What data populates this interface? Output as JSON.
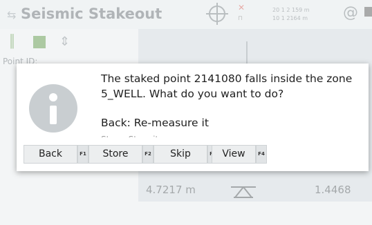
{
  "app": {
    "title": "Seismic Stakeout",
    "coord_line1": "20 1 2 159 m",
    "coord_line2": "10 1 2164 m",
    "field_label": "Point ID:",
    "value_left": "4.7217 m",
    "value_right": "1.4468",
    "icons": [
      "back-icon",
      "gps-target-icon",
      "at-icon",
      "battery-icon",
      "bars-icon",
      "grid-icon",
      "tripod-icon"
    ],
    "accent_color": "#4c8f2f"
  },
  "dialog": {
    "message": "The staked point 2141080 falls inside the zone 5_WELL. What do you want to do?",
    "option_back": "Back: Re-measure it",
    "option_store_partial": "Store: Store it",
    "icon": "info-icon",
    "buttons": [
      {
        "label": "Back",
        "fkey": "F1"
      },
      {
        "label": "Store",
        "fkey": "F2"
      },
      {
        "label": "Skip",
        "fkey": "F3"
      },
      {
        "label": "View",
        "fkey": "F4"
      }
    ]
  }
}
